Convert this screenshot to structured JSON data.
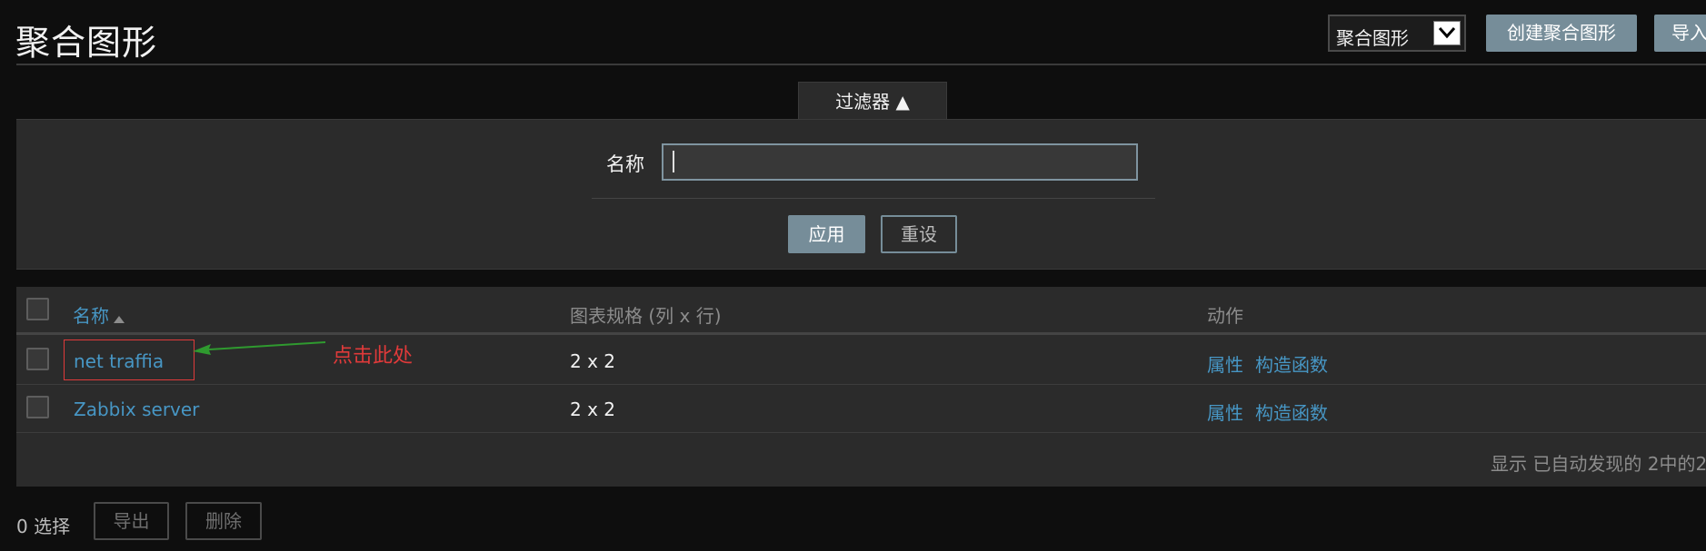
{
  "header": {
    "title": "聚合图形",
    "select_value": "聚合图形",
    "create_button": "创建聚合图形",
    "import_button": "导入"
  },
  "filter": {
    "tab_label": "过滤器 ▲",
    "name_label": "名称",
    "name_value": "",
    "apply_button": "应用",
    "reset_button": "重设"
  },
  "table": {
    "headers": {
      "name": "名称",
      "size": "图表规格 (列 x 行)",
      "actions": "动作"
    },
    "rows": [
      {
        "name": "net traffia",
        "size": "2 x 2",
        "properties": "属性",
        "constructor": "构造函数"
      },
      {
        "name": "Zabbix server",
        "size": "2 x 2",
        "properties": "属性",
        "constructor": "构造函数"
      }
    ],
    "footer": "显示 已自动发现的 2中的2"
  },
  "annotation": {
    "text": "点击此处"
  },
  "bottom": {
    "selected": "0 选择",
    "export_button": "导出",
    "delete_button": "删除"
  },
  "colors": {
    "background": "#0e0e0e",
    "panel": "#2b2b2b",
    "link": "#4796c4",
    "primary_button": "#768d99",
    "annotation": "#e03a3a",
    "arrow": "#2f9a2f"
  }
}
